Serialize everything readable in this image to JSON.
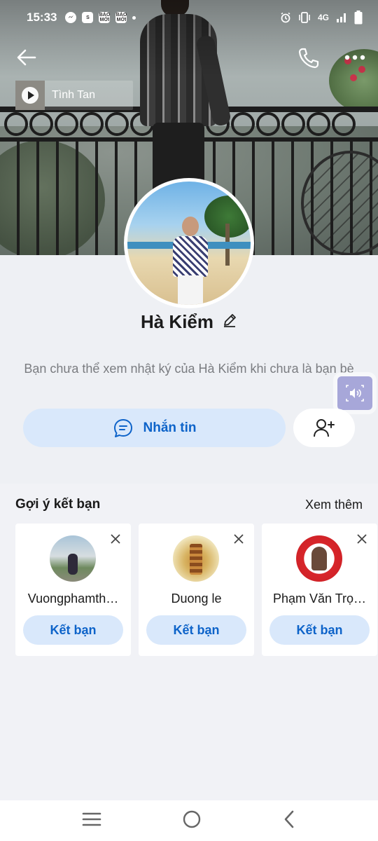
{
  "status_bar": {
    "time": "15:33",
    "notif_icons": [
      "messenger-icon",
      "shopee-icon",
      "bao-moi-icon",
      "bao-moi-icon"
    ],
    "bao_moi_label": "BÁO MỚI",
    "network": "4G",
    "status_icons": [
      "alarm-icon",
      "vibrate-icon",
      "signal-icon",
      "battery-icon"
    ]
  },
  "header": {
    "music_title": "Tình Tan",
    "icons": [
      "back-arrow-icon",
      "phone-icon",
      "more-icon"
    ]
  },
  "profile": {
    "name": "Hà Kiểm",
    "notice": "Bạn chưa thể xem nhật ký của Hà Kiểm khi chưa là bạn bè",
    "message_button": "Nhắn tin"
  },
  "suggestions": {
    "title": "Gợi ý kết bạn",
    "see_more": "Xem thêm",
    "items": [
      {
        "name": "Vuongphamth…",
        "button": "Kết bạn"
      },
      {
        "name": "Duong le",
        "button": "Kết bạn"
      },
      {
        "name": "Phạm Văn Trọ…",
        "button": "Kết bạn"
      }
    ]
  },
  "colors": {
    "accent": "#0d63c9",
    "button_bg": "#d9e8fb",
    "page_bg": "#eef0f4"
  }
}
